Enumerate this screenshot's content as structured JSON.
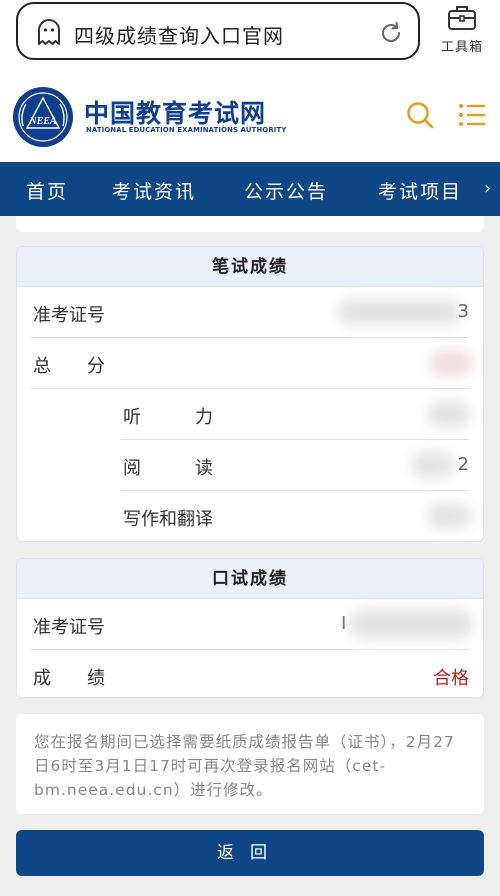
{
  "browser": {
    "search_text": "四级成绩查询入口官网",
    "toolbox_label": "工具箱"
  },
  "site": {
    "logo_emblem_text": "NEEA",
    "name_cn": "中国教育考试网",
    "name_en": "NATIONAL EDUCATION EXAMINATIONS AUTHORITY"
  },
  "nav": {
    "items": [
      "首页",
      "考试资讯",
      "公示公告",
      "考试项目"
    ],
    "more_glyph": "›"
  },
  "written": {
    "title": "笔试成绩",
    "rows": {
      "ticket": {
        "label": "准考证号",
        "value_tail": "3"
      },
      "total": {
        "label": "总　　分"
      },
      "listening": {
        "label": "听　　　力"
      },
      "reading": {
        "label": "阅　　　读",
        "value_tail": "2"
      },
      "writing": {
        "label": "写作和翻译"
      }
    }
  },
  "oral": {
    "title": "口试成绩",
    "rows": {
      "ticket": {
        "label": "准考证号",
        "value_head": "I"
      },
      "result": {
        "label": "成　　绩",
        "value": "合格"
      }
    }
  },
  "notice": "您在报名期间已选择需要纸质成绩报告单（证书），2月27日6时至3月1日17时可再次登录报名网站（cet-bm.neea.edu.cn）进行修改。",
  "back_button": "返回",
  "colors": {
    "nav_bg": "#0f4686",
    "brand_blue": "#0f3f8c",
    "accent_orange": "#e59a1e",
    "pass_red": "#b32222"
  }
}
